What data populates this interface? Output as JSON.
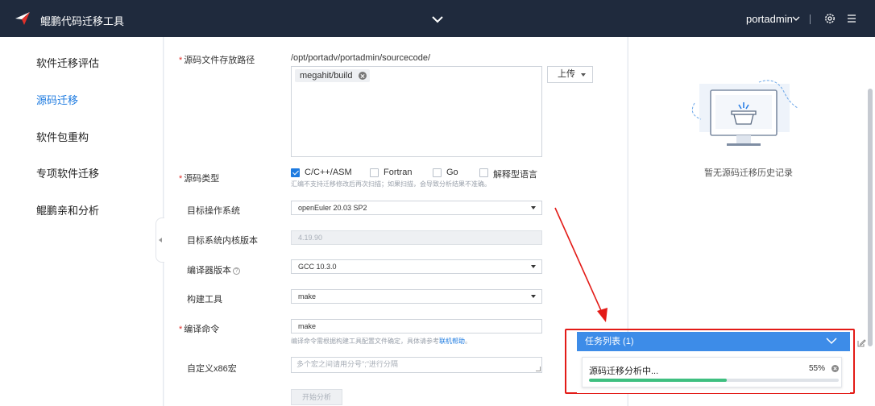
{
  "header": {
    "app_title": "鲲鹏代码迁移工具",
    "user": "portadmin",
    "icons": [
      "logo-icon",
      "chevron-down-icon",
      "gear-icon",
      "menu-icon"
    ]
  },
  "sidebar": {
    "items": [
      {
        "label": "软件迁移评估",
        "active": false
      },
      {
        "label": "源码迁移",
        "active": true
      },
      {
        "label": "软件包重构",
        "active": false
      },
      {
        "label": "专项软件迁移",
        "active": false
      },
      {
        "label": "鲲鹏亲和分析",
        "active": false
      }
    ]
  },
  "form": {
    "source_path": {
      "label": "源码文件存放路径",
      "path": "/opt/portadv/portadmin/sourcecode/",
      "file_chip": "megahit/build",
      "upload_label": "上传"
    },
    "source_type": {
      "label": "源码类型",
      "options": [
        {
          "label": "C/C++/ASM",
          "checked": true
        },
        {
          "label": "Fortran",
          "checked": false
        },
        {
          "label": "Go",
          "checked": false
        },
        {
          "label": "解释型语言",
          "checked": false
        }
      ],
      "hint": "汇编不支持迁移修改后再次扫描；如果扫描，会导致分析结果不准确。"
    },
    "target_os": {
      "label": "目标操作系统",
      "value": "openEuler 20.03 SP2"
    },
    "kernel_version": {
      "label": "目标系统内核版本",
      "value": "4.19.90"
    },
    "compiler_version": {
      "label": "编译器版本",
      "value": "GCC 10.3.0"
    },
    "build_tool": {
      "label": "构建工具",
      "value": "make"
    },
    "compile_command": {
      "label": "编译命令",
      "value": "make",
      "hint_prefix": "编译命令需根据构建工具配置文件确定，具体请参考",
      "hint_link": "联机帮助",
      "hint_suffix": "。"
    },
    "custom_macro": {
      "label": "自定义x86宏",
      "placeholder": "多个宏之间请用分号\";\"进行分隔"
    },
    "start_button": "开始分析"
  },
  "history": {
    "empty_text": "暂无源码迁移历史记录"
  },
  "task_panel": {
    "title": "任务列表 (1)",
    "task_name": "源码迁移分析中...",
    "progress_percent": 55,
    "progress_label": "55%"
  },
  "colors": {
    "header_bg": "#1f2a3d",
    "accent": "#1e7be0",
    "task_header": "#3d8ce8",
    "progress": "#3fbf80",
    "annotation": "#e31b17"
  }
}
